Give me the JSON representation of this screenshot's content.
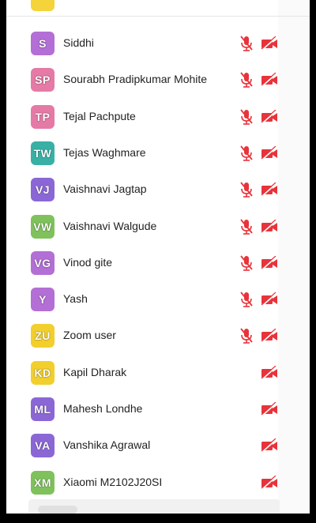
{
  "colors": {
    "mute_red": "#e8333a",
    "frame": "#000000"
  },
  "participants": [
    {
      "initials": "S",
      "name": "Siddhi",
      "color": "#b36fd6",
      "mic_muted": true,
      "video_off": true
    },
    {
      "initials": "SP",
      "name": "Sourabh Pradipkumar Mohite",
      "color": "#e57aa6",
      "mic_muted": true,
      "video_off": true
    },
    {
      "initials": "TP",
      "name": "Tejal Pachpute",
      "color": "#e57aa6",
      "mic_muted": true,
      "video_off": true
    },
    {
      "initials": "TW",
      "name": "Tejas Waghmare",
      "color": "#38b0a6",
      "mic_muted": true,
      "video_off": true
    },
    {
      "initials": "VJ",
      "name": "Vaishnavi Jagtap",
      "color": "#8b67d6",
      "mic_muted": true,
      "video_off": true
    },
    {
      "initials": "VW",
      "name": "Vaishnavi Walgude",
      "color": "#7fc25c",
      "mic_muted": true,
      "video_off": true
    },
    {
      "initials": "VG",
      "name": "Vinod gite",
      "color": "#b36fd6",
      "mic_muted": true,
      "video_off": true
    },
    {
      "initials": "Y",
      "name": "Yash",
      "color": "#b36fd6",
      "mic_muted": true,
      "video_off": true
    },
    {
      "initials": "ZU",
      "name": "Zoom user",
      "color": "#f2cf2c",
      "mic_muted": true,
      "video_off": true
    },
    {
      "initials": "KD",
      "name": "Kapil Dharak",
      "color": "#f2cf2c",
      "mic_muted": false,
      "video_off": true
    },
    {
      "initials": "ML",
      "name": "Mahesh Londhe",
      "color": "#8b67d6",
      "mic_muted": false,
      "video_off": true
    },
    {
      "initials": "VA",
      "name": "Vanshika Agrawal",
      "color": "#8b67d6",
      "mic_muted": false,
      "video_off": true
    },
    {
      "initials": "XM",
      "name": "Xiaomi M2102J20SI",
      "color": "#7fc25c",
      "mic_muted": false,
      "video_off": true
    }
  ]
}
